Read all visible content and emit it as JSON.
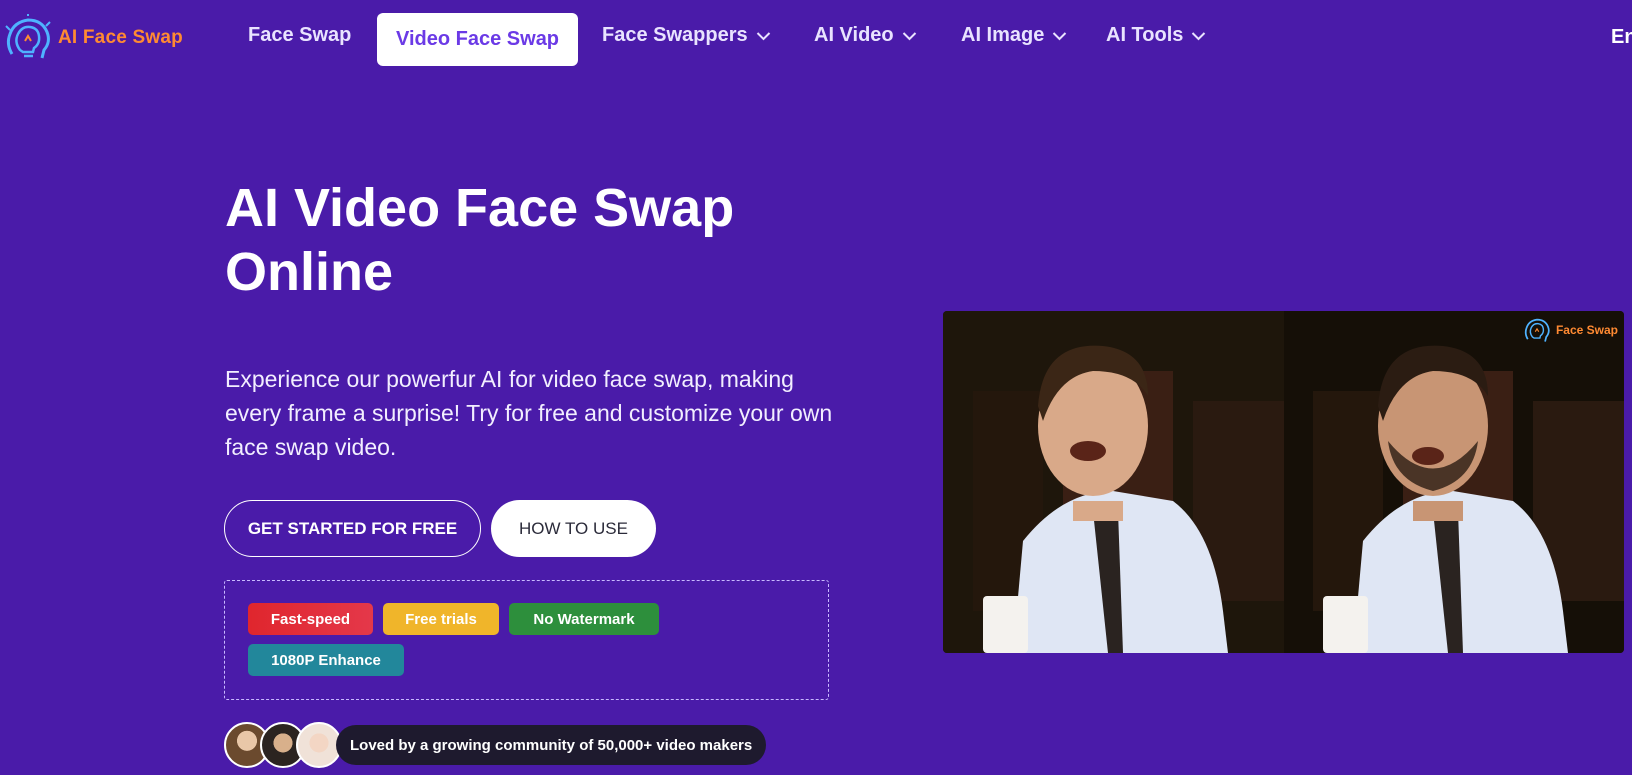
{
  "brand": {
    "name": "AI Face Swap",
    "accent": "#ff8a32",
    "background": "#4a1ba9"
  },
  "nav": {
    "items": [
      {
        "label": "Face Swap",
        "active": false,
        "has_dropdown": false
      },
      {
        "label": "Video Face Swap",
        "active": true,
        "has_dropdown": false
      },
      {
        "label": "Face Swappers",
        "active": false,
        "has_dropdown": true
      },
      {
        "label": "AI Video",
        "active": false,
        "has_dropdown": true
      },
      {
        "label": "AI Image",
        "active": false,
        "has_dropdown": true
      },
      {
        "label": "AI Tools",
        "active": false,
        "has_dropdown": true
      }
    ],
    "language": "En"
  },
  "hero": {
    "title": "AI Video Face Swap Online",
    "description": "Experience our powerfur AI for video face swap, making every frame a surprise! Try for free and customize your own face swap video.",
    "cta_primary": "GET STARTED FOR FREE",
    "cta_secondary": "HOW TO USE",
    "features": [
      {
        "label": "Fast-speed",
        "color": "#e0262d"
      },
      {
        "label": "Free trials",
        "color": "#f0b52a"
      },
      {
        "label": "No Watermark",
        "color": "#2d8f3c"
      },
      {
        "label": "1080P Enhance",
        "color": "#22879b"
      }
    ],
    "community_text": "Loved by a growing community of 50,000+ video makers"
  },
  "preview": {
    "watermark": "Face Swap"
  },
  "icons": {
    "logo": "lightbulb-head-icon",
    "dropdown": "chevron-down-icon"
  }
}
